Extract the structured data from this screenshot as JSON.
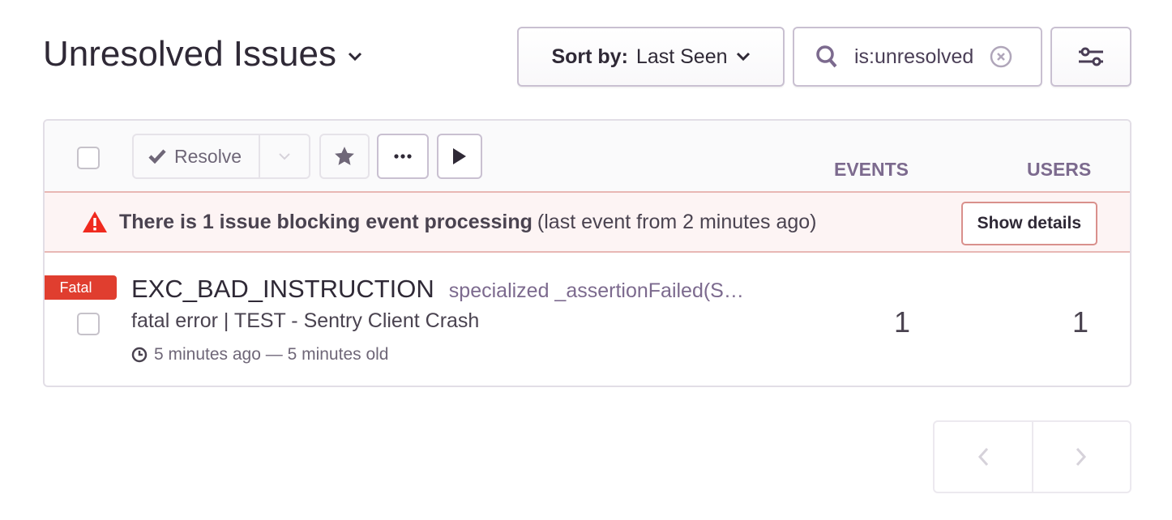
{
  "header": {
    "title": "Unresolved Issues",
    "sort_label": "Sort by:",
    "sort_value": "Last Seen",
    "search_value": "is:unresolved"
  },
  "toolbar": {
    "resolve_label": "Resolve",
    "columns": {
      "events": "EVENTS",
      "users": "USERS"
    }
  },
  "alert": {
    "bold_text": "There is 1 issue blocking event processing",
    "detail_text": "(last event from 2 minutes ago)",
    "button_label": "Show details"
  },
  "issues": [
    {
      "level": "Fatal",
      "title": "EXC_BAD_INSTRUCTION",
      "culprit": "specialized _assertionFailed(S…",
      "subtitle": "fatal error | TEST - Sentry Client Crash",
      "time": "5 minutes ago — 5 minutes old",
      "events": "1",
      "users": "1"
    }
  ],
  "colors": {
    "accent": "#7c6a8e",
    "fatal": "#e03e2f",
    "alert_bg": "#fdf4f4"
  }
}
